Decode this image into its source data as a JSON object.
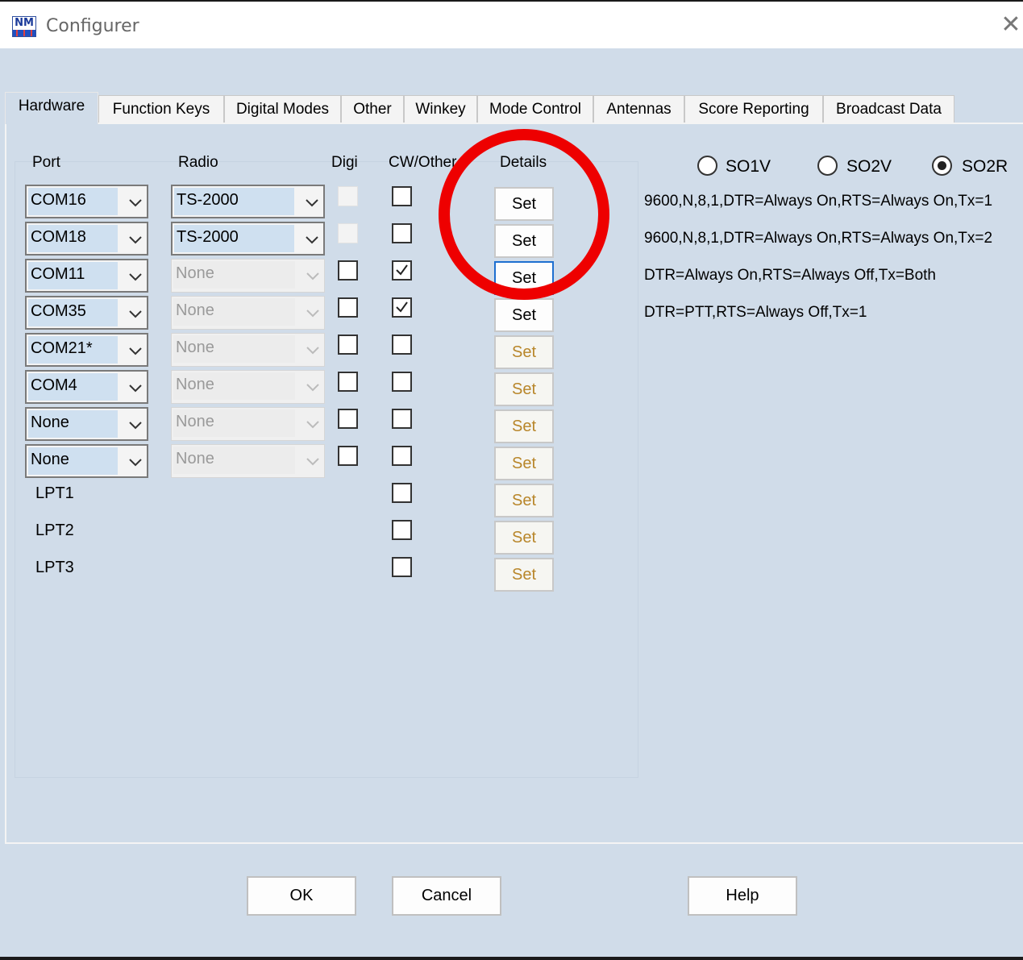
{
  "window": {
    "title": "Configurer",
    "logo_text": "NM",
    "close_glyph": "✕"
  },
  "tabs": [
    {
      "label": "Hardware",
      "active": true
    },
    {
      "label": "Function Keys"
    },
    {
      "label": "Digital Modes"
    },
    {
      "label": "Other"
    },
    {
      "label": "Winkey"
    },
    {
      "label": "Mode Control"
    },
    {
      "label": "Antennas"
    },
    {
      "label": "Score Reporting"
    },
    {
      "label": "Broadcast Data"
    }
  ],
  "headers": {
    "port": "Port",
    "radio": "Radio",
    "digi": "Digi",
    "cw": "CW/Other",
    "details": "Details"
  },
  "ports": [
    {
      "port": "COM16",
      "radio": "TS-2000",
      "radio_enabled": true,
      "digi": false,
      "digi_enabled": false,
      "cw": false,
      "set": "Set",
      "set_enabled": true,
      "detail": "9600,N,8,1,DTR=Always On,RTS=Always On,Tx=1"
    },
    {
      "port": "COM18",
      "radio": "TS-2000",
      "radio_enabled": true,
      "digi": false,
      "digi_enabled": false,
      "cw": false,
      "set": "Set",
      "set_enabled": true,
      "detail": "9600,N,8,1,DTR=Always On,RTS=Always On,Tx=2"
    },
    {
      "port": "COM11",
      "radio": "None",
      "radio_enabled": false,
      "digi": false,
      "digi_enabled": true,
      "cw": true,
      "set": "Set",
      "set_enabled": true,
      "focused": true,
      "detail": "DTR=Always On,RTS=Always Off,Tx=Both"
    },
    {
      "port": "COM35",
      "radio": "None",
      "radio_enabled": false,
      "digi": false,
      "digi_enabled": true,
      "cw": true,
      "set": "Set",
      "set_enabled": true,
      "detail": "DTR=PTT,RTS=Always Off,Tx=1"
    },
    {
      "port": "COM21*",
      "radio": "None",
      "radio_enabled": false,
      "digi": false,
      "digi_enabled": true,
      "cw": false,
      "set": "Set",
      "set_enabled": false,
      "detail": ""
    },
    {
      "port": "COM4",
      "radio": "None",
      "radio_enabled": false,
      "digi": false,
      "digi_enabled": true,
      "cw": false,
      "set": "Set",
      "set_enabled": false,
      "detail": ""
    },
    {
      "port": "None",
      "radio": "None",
      "radio_enabled": false,
      "digi": false,
      "digi_enabled": true,
      "cw": false,
      "set": "Set",
      "set_enabled": false,
      "detail": ""
    },
    {
      "port": "None",
      "radio": "None",
      "radio_enabled": false,
      "digi": false,
      "digi_enabled": true,
      "cw": false,
      "set": "Set",
      "set_enabled": false,
      "detail": ""
    }
  ],
  "lpt_ports": [
    {
      "label": "LPT1",
      "cw": false,
      "set": "Set"
    },
    {
      "label": "LPT2",
      "cw": false,
      "set": "Set"
    },
    {
      "label": "LPT3",
      "cw": false,
      "set": "Set"
    }
  ],
  "operating_mode": {
    "options": [
      "SO1V",
      "SO2V",
      "SO2R"
    ],
    "selected": "SO2R"
  },
  "buttons": {
    "ok": "OK",
    "cancel": "Cancel",
    "help": "Help"
  },
  "colors": {
    "annotation": "#ee0000",
    "panel_bg": "#d0dce9",
    "combo_selected": "#cfe0f0",
    "disabled_set_text": "#b8862a",
    "focus_border": "#1e6fd0"
  }
}
